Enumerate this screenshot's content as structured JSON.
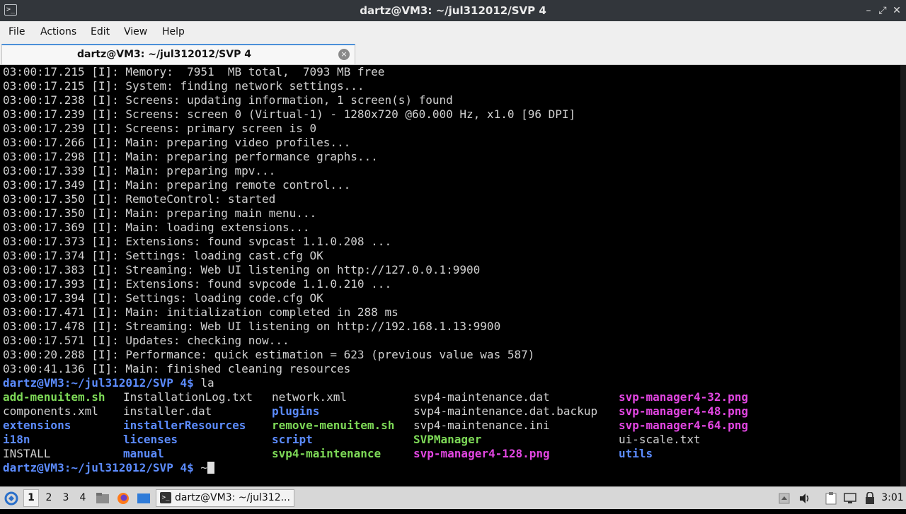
{
  "window": {
    "title": "dartz@VM3: ~/jul312012/SVP 4",
    "icon": "terminal-icon",
    "controls": {
      "minimize": "–",
      "restore": "⤢",
      "close": "✕"
    }
  },
  "menu": [
    "File",
    "Actions",
    "Edit",
    "View",
    "Help"
  ],
  "tab": {
    "label": "dartz@VM3: ~/jul312012/SVP 4",
    "close": "×"
  },
  "terminal": {
    "log_lines": [
      "03:00:17.215 [I]: Memory:  7951  MB total,  7093 MB free",
      "03:00:17.215 [I]: System: finding network settings...",
      "03:00:17.238 [I]: Screens: updating information, 1 screen(s) found",
      "03:00:17.239 [I]: Screens: screen 0 (Virtual-1) - 1280x720 @60.000 Hz, x1.0 [96 DPI]",
      "03:00:17.239 [I]: Screens: primary screen is 0",
      "03:00:17.266 [I]: Main: preparing video profiles...",
      "03:00:17.298 [I]: Main: preparing performance graphs...",
      "03:00:17.339 [I]: Main: preparing mpv...",
      "03:00:17.349 [I]: Main: preparing remote control...",
      "03:00:17.350 [I]: RemoteControl: started",
      "03:00:17.350 [I]: Main: preparing main menu...",
      "03:00:17.369 [I]: Main: loading extensions...",
      "03:00:17.373 [I]: Extensions: found svpcast 1.1.0.208 ...",
      "03:00:17.374 [I]: Settings: loading cast.cfg OK",
      "03:00:17.383 [I]: Streaming: Web UI listening on http://127.0.0.1:9900",
      "03:00:17.393 [I]: Extensions: found svpcode 1.1.0.210 ...",
      "03:00:17.394 [I]: Settings: loading code.cfg OK",
      "03:00:17.471 [I]: Main: initialization completed in 288 ms",
      "03:00:17.478 [I]: Streaming: Web UI listening on http://192.168.1.13:9900",
      "03:00:17.571 [I]: Updates: checking now...",
      "03:00:20.288 [I]: Performance: quick estimation = 623 (previous value was 587)",
      "03:00:41.136 [I]: Main: finished cleaning resources"
    ],
    "prompt": "dartz@VM3:~/jul312012/SVP 4$",
    "command": " la",
    "second_input": " ~",
    "listing_columns": [
      [
        {
          "name": "add-menuitem.sh",
          "type": "script"
        },
        {
          "name": "components.xml",
          "type": "file"
        },
        {
          "name": "extensions",
          "type": "dir"
        },
        {
          "name": "i18n",
          "type": "dir"
        },
        {
          "name": "INSTALL",
          "type": "file"
        }
      ],
      [
        {
          "name": "InstallationLog.txt",
          "type": "file"
        },
        {
          "name": "installer.dat",
          "type": "file"
        },
        {
          "name": "installerResources",
          "type": "dir"
        },
        {
          "name": "licenses",
          "type": "dir"
        },
        {
          "name": "manual",
          "type": "dir"
        }
      ],
      [
        {
          "name": "network.xml",
          "type": "file"
        },
        {
          "name": "plugins",
          "type": "dir"
        },
        {
          "name": "remove-menuitem.sh",
          "type": "script"
        },
        {
          "name": "script",
          "type": "dir"
        },
        {
          "name": "svp4-maintenance",
          "type": "script"
        }
      ],
      [
        {
          "name": "svp4-maintenance.dat",
          "type": "file"
        },
        {
          "name": "svp4-maintenance.dat.backup",
          "type": "file"
        },
        {
          "name": "svp4-maintenance.ini",
          "type": "file"
        },
        {
          "name": "SVPManager",
          "type": "script"
        },
        {
          "name": "svp-manager4-128.png",
          "type": "image"
        }
      ],
      [
        {
          "name": "svp-manager4-32.png",
          "type": "image"
        },
        {
          "name": "svp-manager4-48.png",
          "type": "image"
        },
        {
          "name": "svp-manager4-64.png",
          "type": "image"
        },
        {
          "name": "ui-scale.txt",
          "type": "file"
        },
        {
          "name": "utils",
          "type": "dir"
        }
      ]
    ]
  },
  "taskbar": {
    "workspaces": [
      "1",
      "2",
      "3",
      "4"
    ],
    "active_workspace": "1",
    "task_label": "dartz@VM3: ~/jul312...",
    "clock": "3:01"
  },
  "colors": {
    "prompt": "#5c8cff",
    "directory": "#5c8cff",
    "executable": "#7dd957",
    "image": "#e246e2",
    "text": "#d0d0d0"
  }
}
